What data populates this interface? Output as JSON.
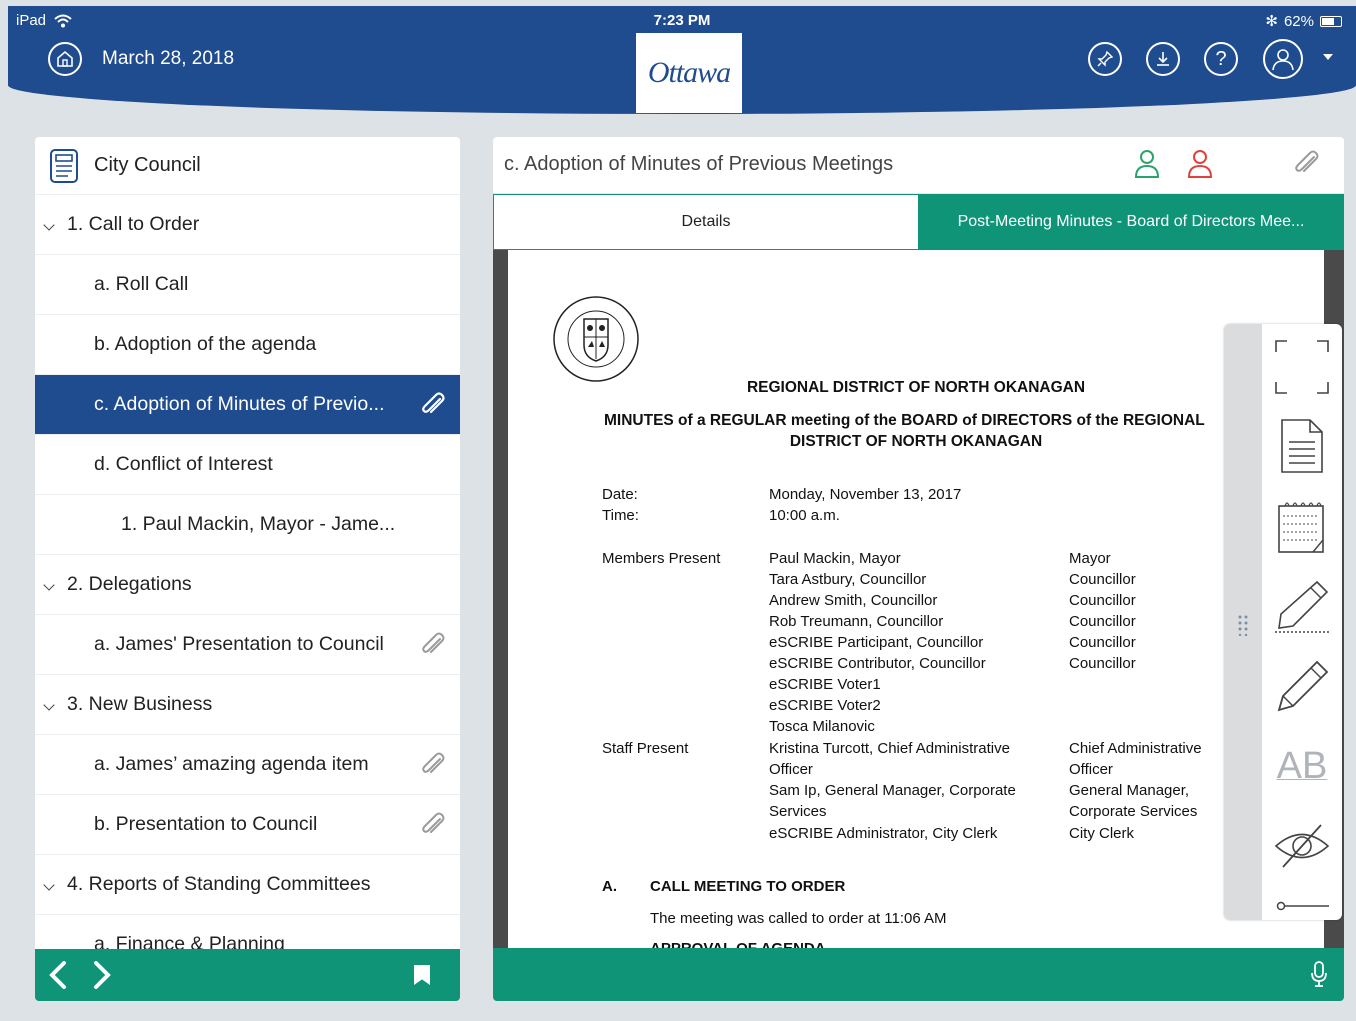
{
  "status_bar": {
    "device": "iPad",
    "time": "7:23 PM",
    "battery": "62%"
  },
  "header": {
    "date": "March 28, 2018",
    "logo_text": "Ottawa",
    "colors": {
      "brand_blue": "#1f4b8f",
      "accent_green": "#0f9478"
    }
  },
  "sidebar": {
    "title": "City Council",
    "items": [
      {
        "label": "1. Call to Order",
        "level": 0,
        "expandable": true
      },
      {
        "label": "a. Roll Call",
        "level": 1
      },
      {
        "label": "b. Adoption of the agenda",
        "level": 1
      },
      {
        "label": "c. Adoption of Minutes of Previo...",
        "level": 1,
        "selected": true,
        "attachment": true
      },
      {
        "label": "d. Conflict of Interest",
        "level": 1
      },
      {
        "label": "1. Paul Mackin, Mayor - Jame...",
        "level": 2
      },
      {
        "label": "2. Delegations",
        "level": 0,
        "expandable": true
      },
      {
        "label": "a. James' Presentation to Council",
        "level": 1,
        "attachment": true
      },
      {
        "label": "3. New Business",
        "level": 0,
        "expandable": true
      },
      {
        "label": "a. James’ amazing agenda item",
        "level": 1,
        "attachment": true
      },
      {
        "label": "b. Presentation to Council",
        "level": 1,
        "attachment": true
      },
      {
        "label": "4. Reports of Standing Committees",
        "level": 0,
        "expandable": true
      },
      {
        "label": "a. Finance & Planning",
        "level": 1
      }
    ]
  },
  "main": {
    "title": "c. Adoption of Minutes of Previous Meetings",
    "tabs": [
      {
        "label": "Details",
        "active": false
      },
      {
        "label": "Post-Meeting Minutes - Board of Directors Mee...",
        "active": true
      }
    ],
    "document": {
      "org": "REGIONAL DISTRICT OF NORTH OKANAGAN",
      "heading_line1": "MINUTES of a REGULAR meeting of the BOARD of DIRECTORS of the REGIONAL",
      "heading_line2": "DISTRICT OF NORTH OKANAGAN",
      "date_label": "Date:",
      "date_value": "Monday, November 13, 2017",
      "time_label": "Time:",
      "time_value": "10:00 a.m.",
      "members_label": "Members Present",
      "members": [
        "Paul Mackin, Mayor",
        "Tara Astbury, Councillor",
        "Andrew Smith, Councillor",
        "Rob Treumann, Councillor",
        "eSCRIBE Participant, Councillor",
        "eSCRIBE Contributor, Councillor",
        "eSCRIBE Voter1",
        "eSCRIBE Voter2",
        "Tosca Milanovic"
      ],
      "member_roles": [
        "Mayor",
        "Councillor",
        "Councillor",
        "Councillor",
        "Councillor",
        "Councillor"
      ],
      "staff_label": "Staff Present",
      "staff": [
        "Kristina Turcott, Chief Administrative",
        "Officer",
        "Sam Ip, General Manager, Corporate",
        "Services",
        "eSCRIBE Administrator, City Clerk"
      ],
      "staff_roles": [
        "Chief Administrative",
        "Officer",
        "General Manager,",
        "Corporate Services",
        "City Clerk"
      ],
      "section_a_letter": "A.",
      "section_a_title": "CALL MEETING TO ORDER",
      "section_a_text": "The meeting was called to order at 11:06 AM",
      "section_b_partial": "APPROVAL OF AGENDA"
    },
    "toolbar": {
      "text_tool": "AB"
    }
  }
}
